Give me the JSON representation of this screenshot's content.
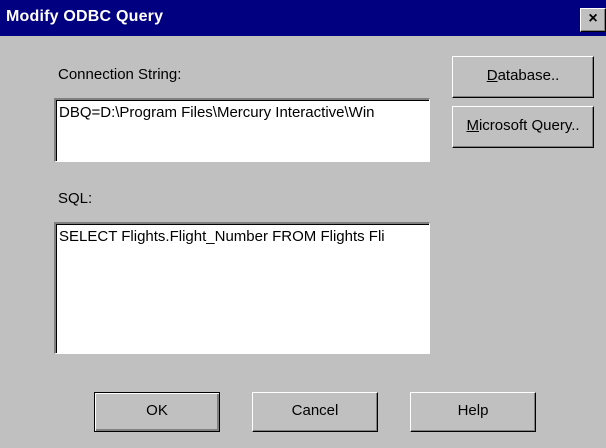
{
  "window": {
    "title": "Modify ODBC Query",
    "close_glyph": "×"
  },
  "connection": {
    "label": "Connection String:",
    "value": "DBQ=D:\\Program Files\\Mercury Interactive\\Win"
  },
  "sql": {
    "label": "SQL:",
    "value": "SELECT Flights.Flight_Number  FROM Flights Fli"
  },
  "buttons": {
    "database": {
      "mnemonic": "D",
      "rest": "atabase.."
    },
    "microsoft_query": {
      "mnemonic": "M",
      "rest": "icrosoft Query.."
    },
    "ok": "OK",
    "cancel": "Cancel",
    "help": "Help"
  },
  "colors": {
    "titlebar": "#000080",
    "face": "#c0c0c0"
  }
}
